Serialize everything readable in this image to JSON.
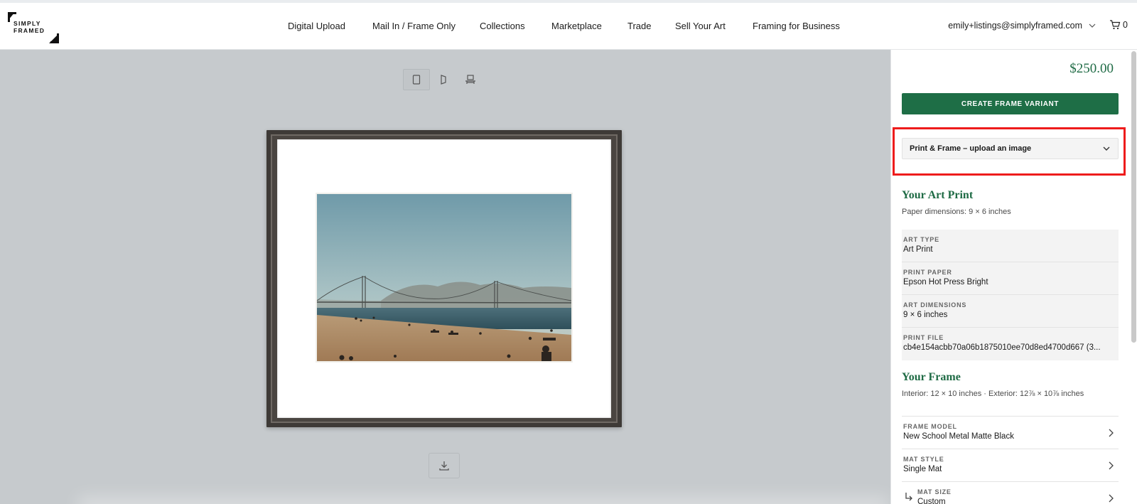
{
  "header": {
    "logo_line1": "SIMPLY",
    "logo_line2": "FRAMED",
    "nav": [
      {
        "label": "Digital Upload"
      },
      {
        "label": "Mail In / Frame Only"
      },
      {
        "label": "Collections"
      },
      {
        "label": "Marketplace"
      },
      {
        "label": "Trade"
      },
      {
        "label": "Sell Your Art"
      },
      {
        "label": "Framing for Business"
      }
    ],
    "account_email": "emily+listings@simplyframed.com",
    "cart_count": "0"
  },
  "preview": {
    "view_icons": [
      "portrait-view-icon",
      "angle-view-icon",
      "wall-view-icon"
    ],
    "download_icon": "download-icon"
  },
  "panel": {
    "price": "$250.00",
    "create_button": "CREATE FRAME VARIANT",
    "product_select": "Print & Frame – upload an image",
    "art_print": {
      "title": "Your Art Print",
      "subtitle": "Paper dimensions: 9 × 6 inches",
      "specs": [
        {
          "key": "ART TYPE",
          "value": "Art Print"
        },
        {
          "key": "PRINT PAPER",
          "value": "Epson Hot Press Bright"
        },
        {
          "key": "ART DIMENSIONS",
          "value": "9 × 6 inches"
        },
        {
          "key": "PRINT FILE",
          "value": "cb4e154acbb70a06b1875010ee70d8ed4700d667 (3..."
        }
      ]
    },
    "frame": {
      "title": "Your Frame",
      "subtitle": "Interior: 12 × 10 inches · Exterior: 12⅞ × 10⅞ inches",
      "items": [
        {
          "key": "FRAME MODEL",
          "value": "New School Metal Matte Black"
        },
        {
          "key": "MAT STYLE",
          "value": "Single Mat"
        },
        {
          "key": "MAT SIZE",
          "value": "Custom"
        }
      ]
    }
  }
}
